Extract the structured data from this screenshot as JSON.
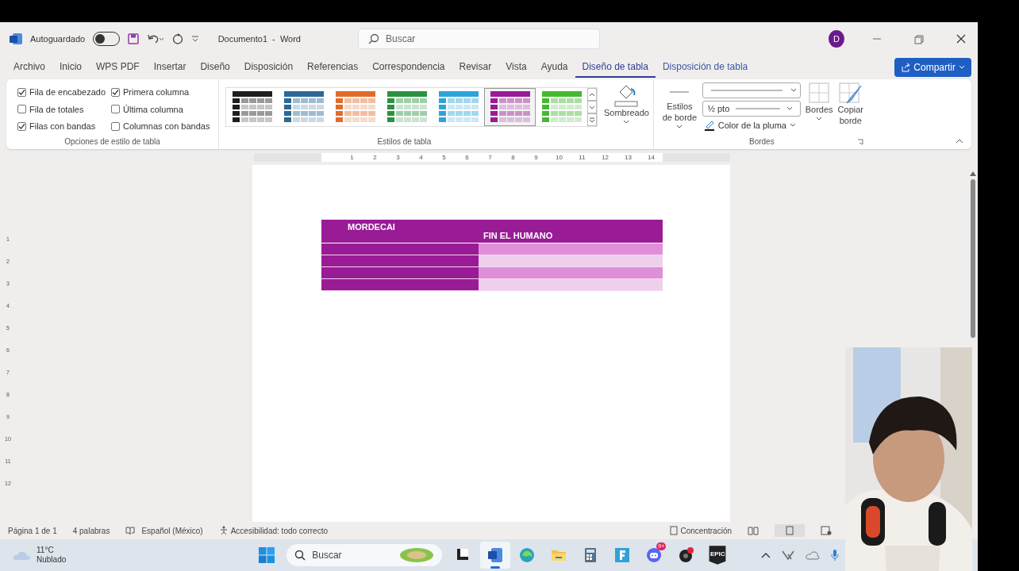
{
  "title_bar": {
    "autosave_label": "Autoguardado",
    "autosave_on": false,
    "document_title": "Documento1  -  Word",
    "search_placeholder": "Buscar",
    "avatar": "D"
  },
  "menu_tabs": [
    {
      "label": "Archivo",
      "kind": "normal",
      "selected": false
    },
    {
      "label": "Inicio",
      "kind": "normal",
      "selected": false
    },
    {
      "label": "WPS PDF",
      "kind": "normal",
      "selected": false
    },
    {
      "label": "Insertar",
      "kind": "normal",
      "selected": false
    },
    {
      "label": "Diseño",
      "kind": "normal",
      "selected": false
    },
    {
      "label": "Disposición",
      "kind": "normal",
      "selected": false
    },
    {
      "label": "Referencias",
      "kind": "normal",
      "selected": false
    },
    {
      "label": "Correspondencia",
      "kind": "normal",
      "selected": false
    },
    {
      "label": "Revisar",
      "kind": "normal",
      "selected": false
    },
    {
      "label": "Vista",
      "kind": "normal",
      "selected": false
    },
    {
      "label": "Ayuda",
      "kind": "normal",
      "selected": false
    },
    {
      "label": "Diseño de tabla",
      "kind": "contextual",
      "selected": true
    },
    {
      "label": "Disposición de tabla",
      "kind": "contextual",
      "selected": false
    }
  ],
  "share_button": "Compartir",
  "style_options": {
    "title": "Opciones de estilo de tabla",
    "items": [
      {
        "label": "Fila de encabezado",
        "checked": true
      },
      {
        "label": "Primera columna",
        "checked": true
      },
      {
        "label": "Fila de totales",
        "checked": false
      },
      {
        "label": "Última columna",
        "checked": false
      },
      {
        "label": "Filas con bandas",
        "checked": true
      },
      {
        "label": "Columnas con bandas",
        "checked": false
      }
    ]
  },
  "table_styles": {
    "title": "Estilos de tabla",
    "items": [
      {
        "color": "#1e1e1e",
        "selected": false
      },
      {
        "color": "#2b6a94",
        "selected": false
      },
      {
        "color": "#e06c2c",
        "selected": false
      },
      {
        "color": "#2a9240",
        "selected": false
      },
      {
        "color": "#2ea3d9",
        "selected": false
      },
      {
        "color": "#9a1b96",
        "selected": true
      },
      {
        "color": "#43b92f",
        "selected": false
      }
    ]
  },
  "shading_button": "Sombreado",
  "borders": {
    "title": "Bordes",
    "border_styles": "Estilos de borde",
    "line_weight": "½ pto",
    "pen_color": "Color de la pluma",
    "borders_button": "Bordes",
    "copy_border": "Copiar borde"
  },
  "ruler": {
    "numbers": [
      "1",
      "2",
      "3",
      "4",
      "5",
      "6",
      "7",
      "8",
      "9",
      "10",
      "11",
      "12",
      "13",
      "14"
    ],
    "side_numbers": [
      "1",
      "2",
      "3",
      "4",
      "5",
      "6",
      "7",
      "8",
      "9",
      "10",
      "11",
      "12"
    ]
  },
  "document": {
    "table": {
      "header": [
        "MORDECAI",
        "FIN EL HUMANO"
      ],
      "rows": [
        {
          "shaded": true
        },
        {
          "shaded": false
        },
        {
          "shaded": true
        },
        {
          "shaded": false
        }
      ]
    }
  },
  "status_bar": {
    "page": "Página 1 de 1",
    "words": "4 palabras",
    "language": "Español (México)",
    "accessibility": "Accesibilidad: todo correcto",
    "focus": "Concentración"
  },
  "taskbar": {
    "weather_temp": "11°C",
    "weather_desc": "Nublado",
    "search_placeholder": "Buscar",
    "apps": [
      {
        "kind": "task-view",
        "selected": false
      },
      {
        "kind": "word",
        "selected": true
      },
      {
        "kind": "edge",
        "selected": false
      },
      {
        "kind": "folder",
        "selected": false
      },
      {
        "kind": "calculator",
        "selected": false
      },
      {
        "kind": "f-app",
        "selected": false
      },
      {
        "kind": "chat",
        "badge": "9+",
        "selected": false
      },
      {
        "kind": "recorder",
        "selected": false
      },
      {
        "kind": "store",
        "label": "EPIC",
        "selected": false
      }
    ]
  }
}
